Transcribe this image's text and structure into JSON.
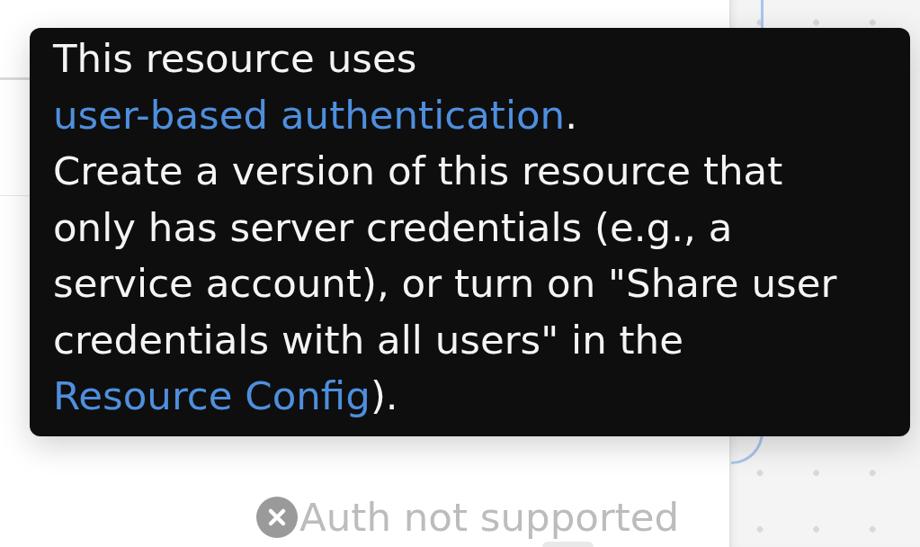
{
  "canvas": {
    "node": {
      "selected": true
    }
  },
  "tooltip": {
    "paragraphs": [
      [
        {
          "kind": "text",
          "text": "This resource uses "
        },
        {
          "kind": "link",
          "text": "user-based authentication"
        },
        {
          "kind": "text",
          "text": "."
        }
      ],
      [
        {
          "kind": "text",
          "text": "Create a version of this resource that only has server credentials (e.g., a service account), or turn on \"Share user credentials with all users\" in the "
        },
        {
          "kind": "link",
          "text": "Resource Config"
        },
        {
          "kind": "text",
          "text": ")."
        }
      ]
    ]
  },
  "panel": {
    "status": {
      "text": "Auth not supported"
    }
  }
}
